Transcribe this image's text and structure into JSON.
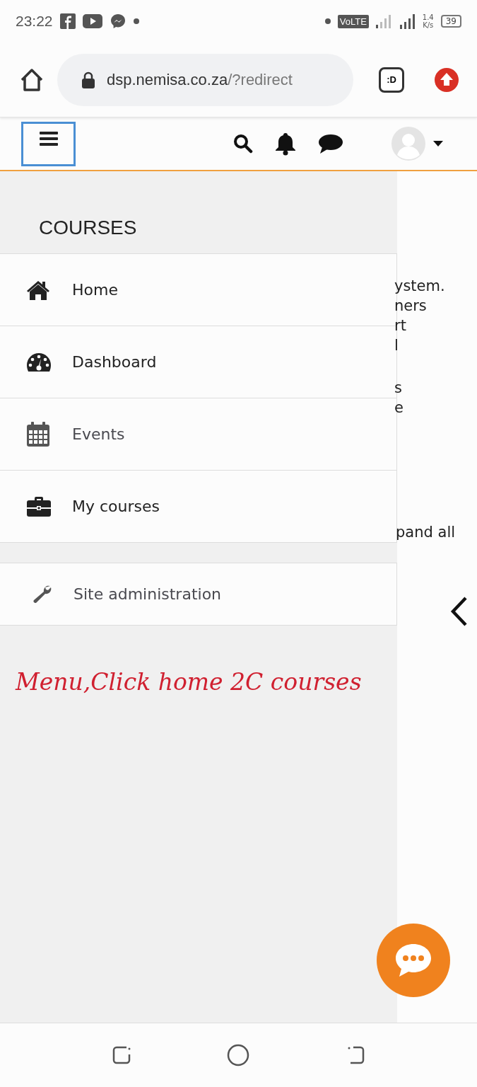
{
  "status_bar": {
    "time": "23:22",
    "network": "VoLTE",
    "speed_value": "1.4",
    "speed_unit": "K/s",
    "battery": "39"
  },
  "browser": {
    "url_host": "dsp.nemisa.co.za",
    "url_path": "/?redirect",
    "tab_badge": ":D"
  },
  "drawer": {
    "heading": "COURSES",
    "items": [
      {
        "label": "Home"
      },
      {
        "label": "Dashboard"
      },
      {
        "label": "Events"
      },
      {
        "label": "My courses"
      }
    ],
    "admin_item": {
      "label": "Site administration"
    }
  },
  "page_fragments": [
    [
      "ystem.",
      "ners",
      "rt",
      "l"
    ],
    [
      "s",
      "e"
    ]
  ],
  "expand_fragment": "pand all",
  "annotation": "Menu,Click home 2C courses"
}
